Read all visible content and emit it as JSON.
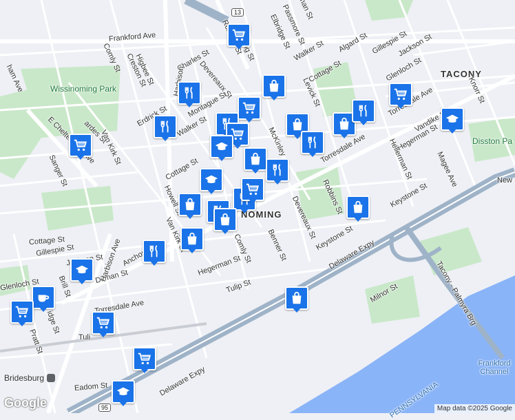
{
  "areas": {
    "tacony": "TACONY",
    "wissinoming": "NOMING",
    "park": "Wissinoming Park",
    "disston": "Disston Pa",
    "channel": "Frankford Channel",
    "bridesburg": "Bridesburg",
    "penn": "PENNSYLVANIA"
  },
  "highway_shields": {
    "top": "13",
    "bottom": "95"
  },
  "streets": {
    "frankford": "Frankford Ave",
    "comly_nw": "Comly St",
    "higbee": "Higbee St",
    "creston": "Creston St",
    "charles": "Charles St",
    "devereaux_n": "Devereaux St",
    "montague": "Montague St",
    "erdrick": "Erdrick St",
    "walker": "Walker St",
    "walker_ne": "Walker St",
    "cottage_n": "Cottage St",
    "cottage_mid": "Cottage St",
    "cottage_sw": "Cottage St",
    "robbins_n": "Robbins St",
    "passmore": "Passmore St",
    "elbridge": "Elbridge St",
    "algard": "Algard St",
    "gillespie_ne": "Gillespie St",
    "jackson_ne": "Jackson St",
    "glenloch_ne": "Glenloch St",
    "levick": "Levick St",
    "torresdale_e": "Torresdale Ave",
    "torresdale_mid": "Torresdale Ave",
    "torresdale_sw": "Torresdale Ave",
    "vandike": "Vandike St",
    "hegerman_e": "Hegerman St",
    "helleman": "Hellerman St",
    "knorr": "Knorr St",
    "magee": "Magee Ave",
    "keystone_e": "Keystone St",
    "keystone_mid": "Keystone St",
    "robbins_s": "Robbins St",
    "devereaux_s": "Devereaux St",
    "benner": "Benner St",
    "comly_s": "Comly St",
    "hegerman_s": "Hegerman St",
    "tulip": "Tulip St",
    "delaware_mid": "Delaware Expy",
    "delaware_sw": "Delaware Expy",
    "milnor": "Milnor St",
    "tacony_br": "Tacony - Palmyra Brg",
    "howell": "Howell St",
    "vankirk_w": "Van Kirk St",
    "vankirk_s": "Van Kirk St",
    "anchor": "Anchor St",
    "ditman": "Ditman St",
    "harbison": "Harbison Ave",
    "gillespie_w": "Gillespie St",
    "jackson_w": "Jackson St",
    "glenloch_w": "Glenloch St",
    "brill": "Brill St",
    "pratt": "Pratt St",
    "eadom": "Eadom St",
    "sanger": "Sanger St",
    "e_cheltenham": "E Cheltenham Ave",
    "cheltenham_w": "ham Ave",
    "mckinley": "McKinley",
    "new": "New",
    "tulip_w": "Tuli",
    "ridge": "idge St",
    "darrah": "ardes St",
    "harbison_n": "Harbison",
    "orthodox": "ng St",
    "levick_top": "lerman St"
  },
  "markers": [
    {
      "type": "grocery",
      "name": "marker-grocery-1"
    },
    {
      "type": "shopping",
      "name": "marker-shopping-1"
    },
    {
      "type": "restaurant",
      "name": "marker-restaurant-1"
    },
    {
      "type": "grocery",
      "name": "marker-grocery-2"
    },
    {
      "type": "restaurant",
      "name": "marker-restaurant-2"
    },
    {
      "type": "restaurant",
      "name": "marker-restaurant-3"
    },
    {
      "type": "shopping",
      "name": "marker-shopping-2"
    },
    {
      "type": "restaurant",
      "name": "marker-restaurant-4"
    },
    {
      "type": "shopping",
      "name": "marker-shopping-3"
    },
    {
      "type": "restaurant",
      "name": "marker-restaurant-5"
    },
    {
      "type": "grocery",
      "name": "marker-grocery-3"
    },
    {
      "type": "school",
      "name": "marker-school-1"
    },
    {
      "type": "shopping",
      "name": "marker-shopping-4"
    },
    {
      "type": "restaurant",
      "name": "marker-restaurant-6"
    },
    {
      "type": "school",
      "name": "marker-school-2"
    },
    {
      "type": "grocery",
      "name": "marker-grocery-4"
    },
    {
      "type": "restaurant",
      "name": "marker-restaurant-7"
    },
    {
      "type": "grocery",
      "name": "marker-grocery-5"
    },
    {
      "type": "shopping",
      "name": "marker-shopping-5"
    },
    {
      "type": "restaurant",
      "name": "marker-restaurant-8"
    },
    {
      "type": "shopping",
      "name": "marker-shopping-6"
    },
    {
      "type": "shopping",
      "name": "marker-shopping-7"
    },
    {
      "type": "restaurant",
      "name": "marker-restaurant-9"
    },
    {
      "type": "school",
      "name": "marker-school-3"
    },
    {
      "type": "cafe",
      "name": "marker-cafe-1"
    },
    {
      "type": "grocery",
      "name": "marker-grocery-6"
    },
    {
      "type": "grocery",
      "name": "marker-grocery-7"
    },
    {
      "type": "shopping",
      "name": "marker-shopping-8"
    },
    {
      "type": "grocery",
      "name": "marker-grocery-8"
    },
    {
      "type": "school",
      "name": "marker-school-4"
    },
    {
      "type": "shopping",
      "name": "marker-shopping-9"
    },
    {
      "type": "grocery",
      "name": "marker-grocery-9"
    },
    {
      "type": "school",
      "name": "marker-school-5"
    }
  ],
  "attribution": "Map data ©2025 Google",
  "logo": "Google",
  "colors": {
    "marker": "#1a73e8",
    "road": "#ffffff",
    "highway": "#9fb3c8",
    "park": "#c9e8c9",
    "water": "#8ab4f8",
    "land": "#eef0f5"
  }
}
